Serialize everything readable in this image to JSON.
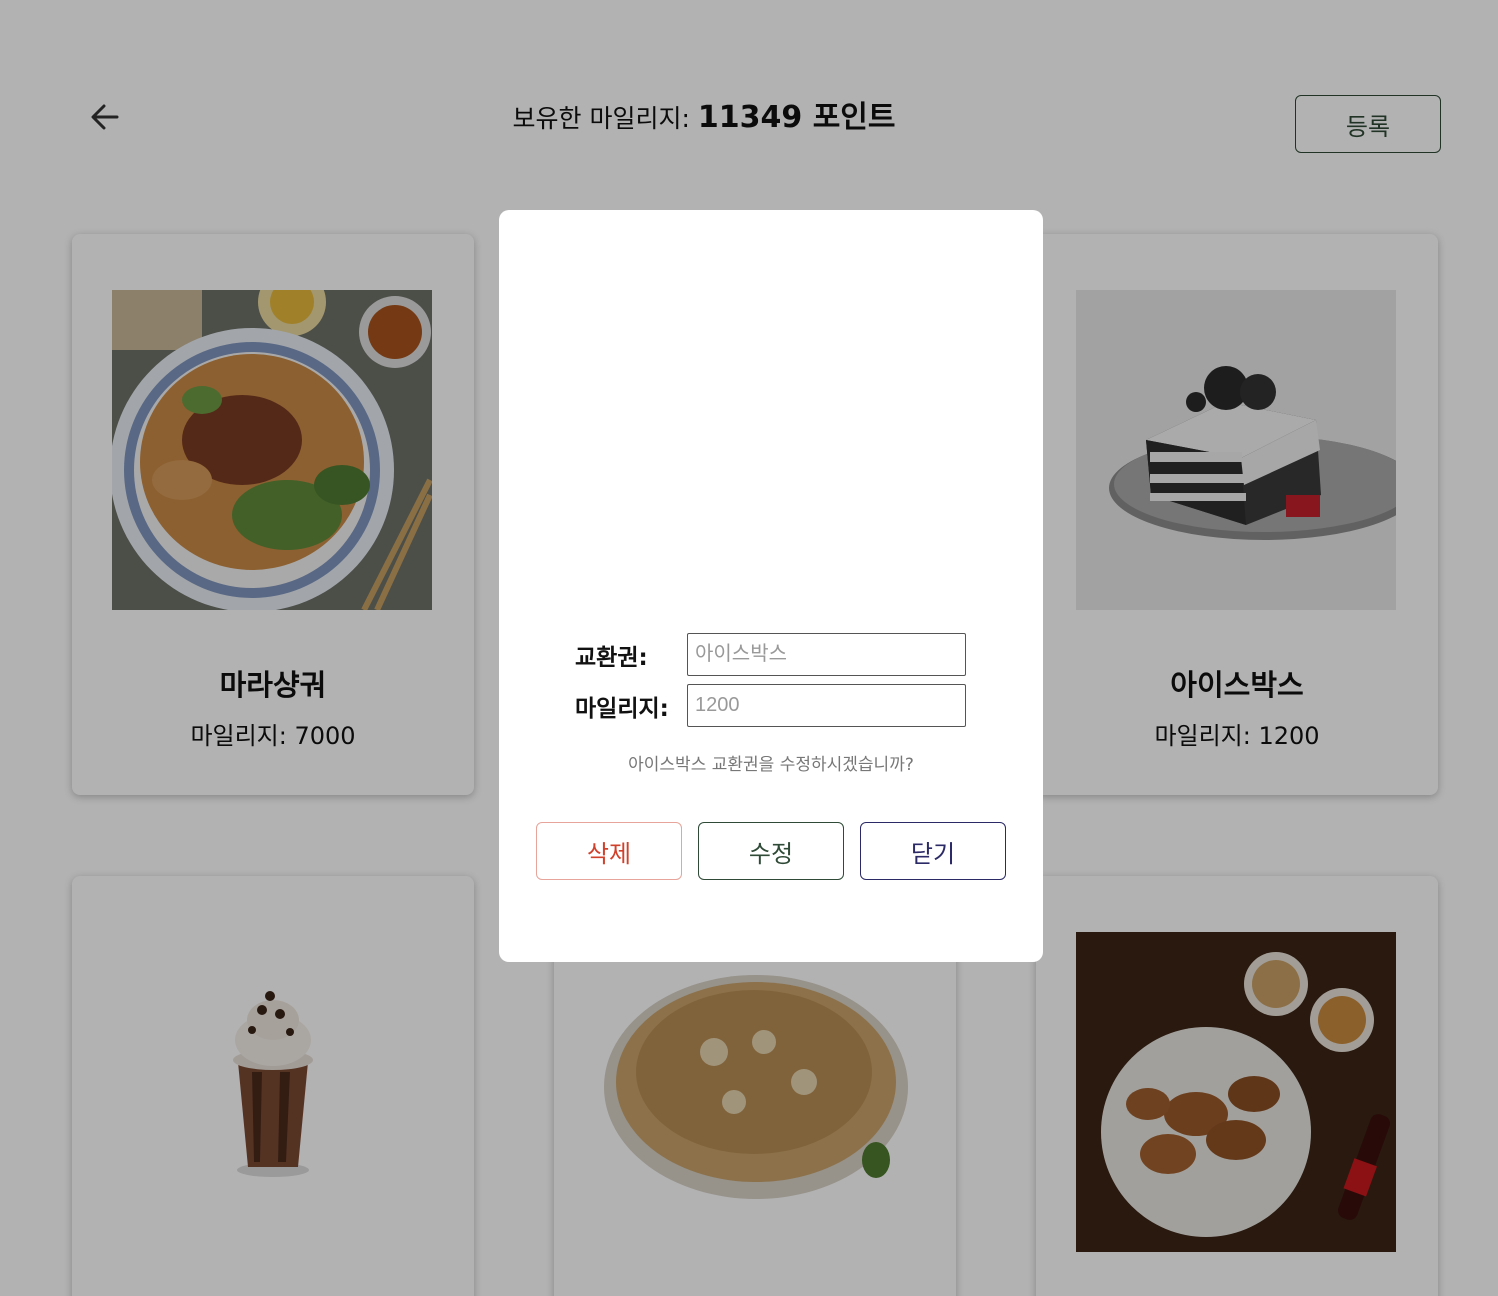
{
  "header": {
    "back_icon": "arrow-left-icon",
    "mileage_label": "보유한 마일리지:",
    "mileage_points": "11349 포인트",
    "register_label": "등록"
  },
  "cards": [
    {
      "name": "마라샹궈",
      "mileage": "마일리지: 7000",
      "image": "mala-xiangguo-photo"
    },
    {
      "name": "아이스박스",
      "mileage": "마일리지: 1200",
      "image": "oreo-icebox-cake-photo"
    },
    {
      "name": "",
      "mileage": "",
      "image": "chocolate-frappe-photo"
    },
    {
      "name": "",
      "mileage": "",
      "image": "chicken-dish-photo"
    },
    {
      "name": "",
      "mileage": "",
      "image": "fried-chicken-cola-photo"
    }
  ],
  "modal": {
    "voucher_label": "교환권:",
    "voucher_placeholder": "아이스박스",
    "mileage_label": "마일리지:",
    "mileage_placeholder": "1200",
    "confirm_text": "아이스박스 교환권을 수정하시겠습니까?",
    "delete_label": "삭제",
    "edit_label": "수정",
    "close_label": "닫기"
  },
  "colors": {
    "overlay": "rgba(0,0,0,0.30)",
    "green": "#2f4a36",
    "red": "#d0402a",
    "navy": "#2c2a66"
  }
}
